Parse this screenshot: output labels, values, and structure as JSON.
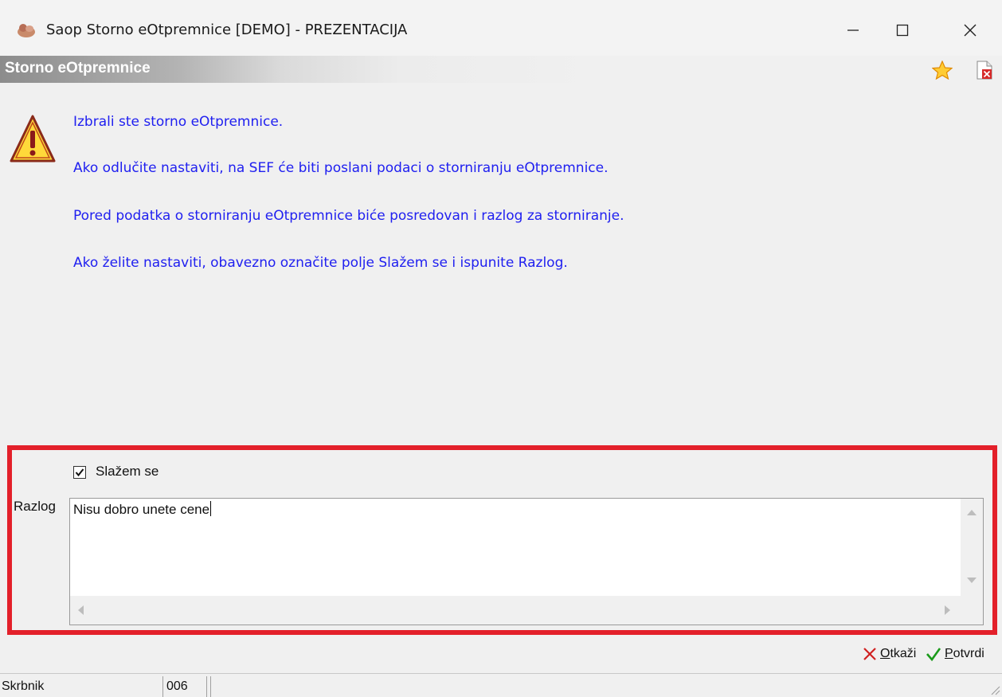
{
  "window": {
    "title": "Saop Storno eOtpremnice [DEMO] - PREZENTACIJA",
    "controls": [
      "minimize-icon",
      "maximize-icon",
      "close-icon"
    ]
  },
  "header": {
    "title": "Storno eOtpremnice",
    "icons": [
      "star-icon",
      "pdf-delete-icon"
    ]
  },
  "messages": [
    "Izbrali ste storno eOtpremnice.",
    "Ako odlučite nastaviti, na SEF će biti poslani podaci o storniranju eOtpremnice.",
    "Pored podatka o storniranju eOtpremnice biće posredovan i razlog za storniranje.",
    "Ako želite nastaviti, obavezno označite polje Slažem se i ispunite Razlog."
  ],
  "form": {
    "agree_label": "Slažem se",
    "agree_checked": true,
    "reason_label": "Razlog",
    "reason_value": "Nisu dobro unete cene"
  },
  "buttons": {
    "cancel": {
      "accel": "O",
      "rest": "tkaži"
    },
    "confirm": {
      "accel": "P",
      "rest": "otvrdi"
    }
  },
  "status": {
    "field1": "Skrbnik",
    "field2": "006",
    "field3": ""
  },
  "colors": {
    "message_text": "#2020f0",
    "highlight_border": "#e3202a",
    "header_text": "#ffffff"
  }
}
